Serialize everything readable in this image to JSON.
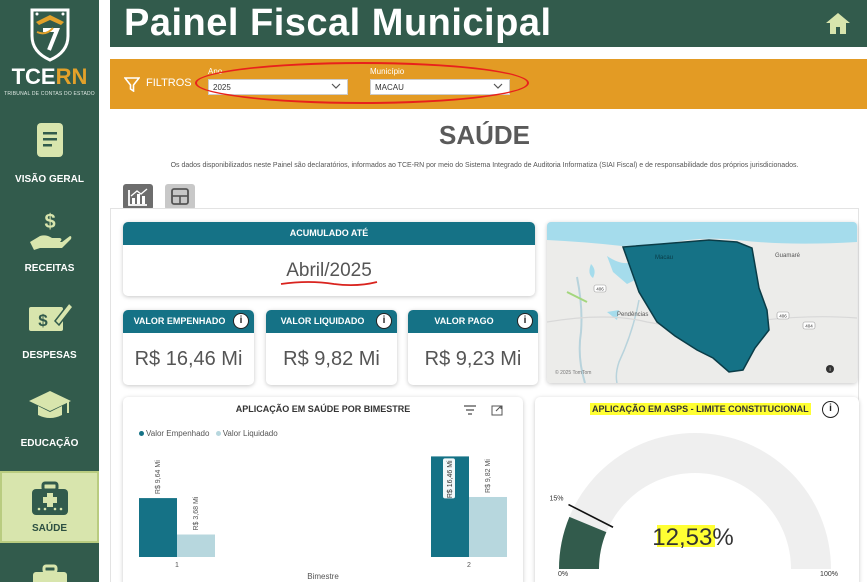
{
  "app": {
    "logo_main": "TCE",
    "logo_accent": "RN",
    "logo_sub": "TRIBUNAL DE CONTAS DO ESTADO",
    "title": "Painel Fiscal Municipal"
  },
  "sidebar": {
    "items": [
      {
        "label": "VISÃO GERAL",
        "icon": "document-icon"
      },
      {
        "label": "RECEITAS",
        "icon": "hand-dollar-icon"
      },
      {
        "label": "DESPESAS",
        "icon": "bill-icon"
      },
      {
        "label": "EDUCAÇÃO",
        "icon": "graduation-cap-icon"
      },
      {
        "label": "SAÚDE",
        "icon": "medical-kit-icon",
        "active": true
      }
    ]
  },
  "filters": {
    "label": "FILTROS",
    "ano_label": "Ano",
    "ano_value": "2025",
    "municipio_label": "Município",
    "municipio_value": "MACAU"
  },
  "page": {
    "title": "SAÚDE",
    "note": "Os dados disponibilizados neste Painel são declaratórios, informados ao TCE-RN por meio do Sistema Integrado de Auditoria Informatiza (SIAI Fiscal) e de responsabilidade dos próprios jurisdicionados."
  },
  "accumulated": {
    "label": "ACUMULADO ATÉ",
    "value": "Abril/2025"
  },
  "kpis": [
    {
      "label": "VALOR EMPENHADO",
      "value": "R$ 16,46 Mi"
    },
    {
      "label": "VALOR LIQUIDADO",
      "value": "R$ 9,82 Mi"
    },
    {
      "label": "VALOR PAGO",
      "value": "R$ 9,23 Mi"
    }
  ],
  "map": {
    "places": [
      "Macau",
      "Guamaré",
      "Pendências"
    ],
    "roads": [
      "406",
      "406",
      "404"
    ],
    "attribution": "© 2025 TomTom"
  },
  "chart_data": [
    {
      "type": "bar",
      "title": "APLICAÇÃO EM SAÚDE POR BIMESTRE",
      "xlabel": "Bimestre",
      "categories": [
        "1",
        "2"
      ],
      "series": [
        {
          "name": "Valor Empenhado",
          "values": [
            9.64,
            16.46
          ],
          "labels": [
            "R$ 9,64 Mi",
            "R$ 16,46 Mi"
          ],
          "color": "#157286"
        },
        {
          "name": "Valor Liquidado",
          "values": [
            3.68,
            9.82
          ],
          "labels": [
            "R$ 3,68 Mi",
            "R$ 9,82 Mi"
          ],
          "color": "#b7d7de"
        }
      ],
      "ylim": [
        0,
        18
      ]
    },
    {
      "type": "gauge",
      "title": "APLICAÇÃO EM ASPS - LIMITE CONSTITUCIONAL",
      "value": 12.53,
      "value_label": "12,53%",
      "min": 0,
      "max": 100,
      "min_label": "0%",
      "max_label": "100%",
      "target": 15,
      "target_label": "15%",
      "fill_color": "#325b4c",
      "track_color": "#efefef"
    }
  ],
  "colors": {
    "sidebar": "#325b4c",
    "filters_bar": "#e39b24",
    "card_header": "#157286",
    "highlight": "#ffff33"
  }
}
